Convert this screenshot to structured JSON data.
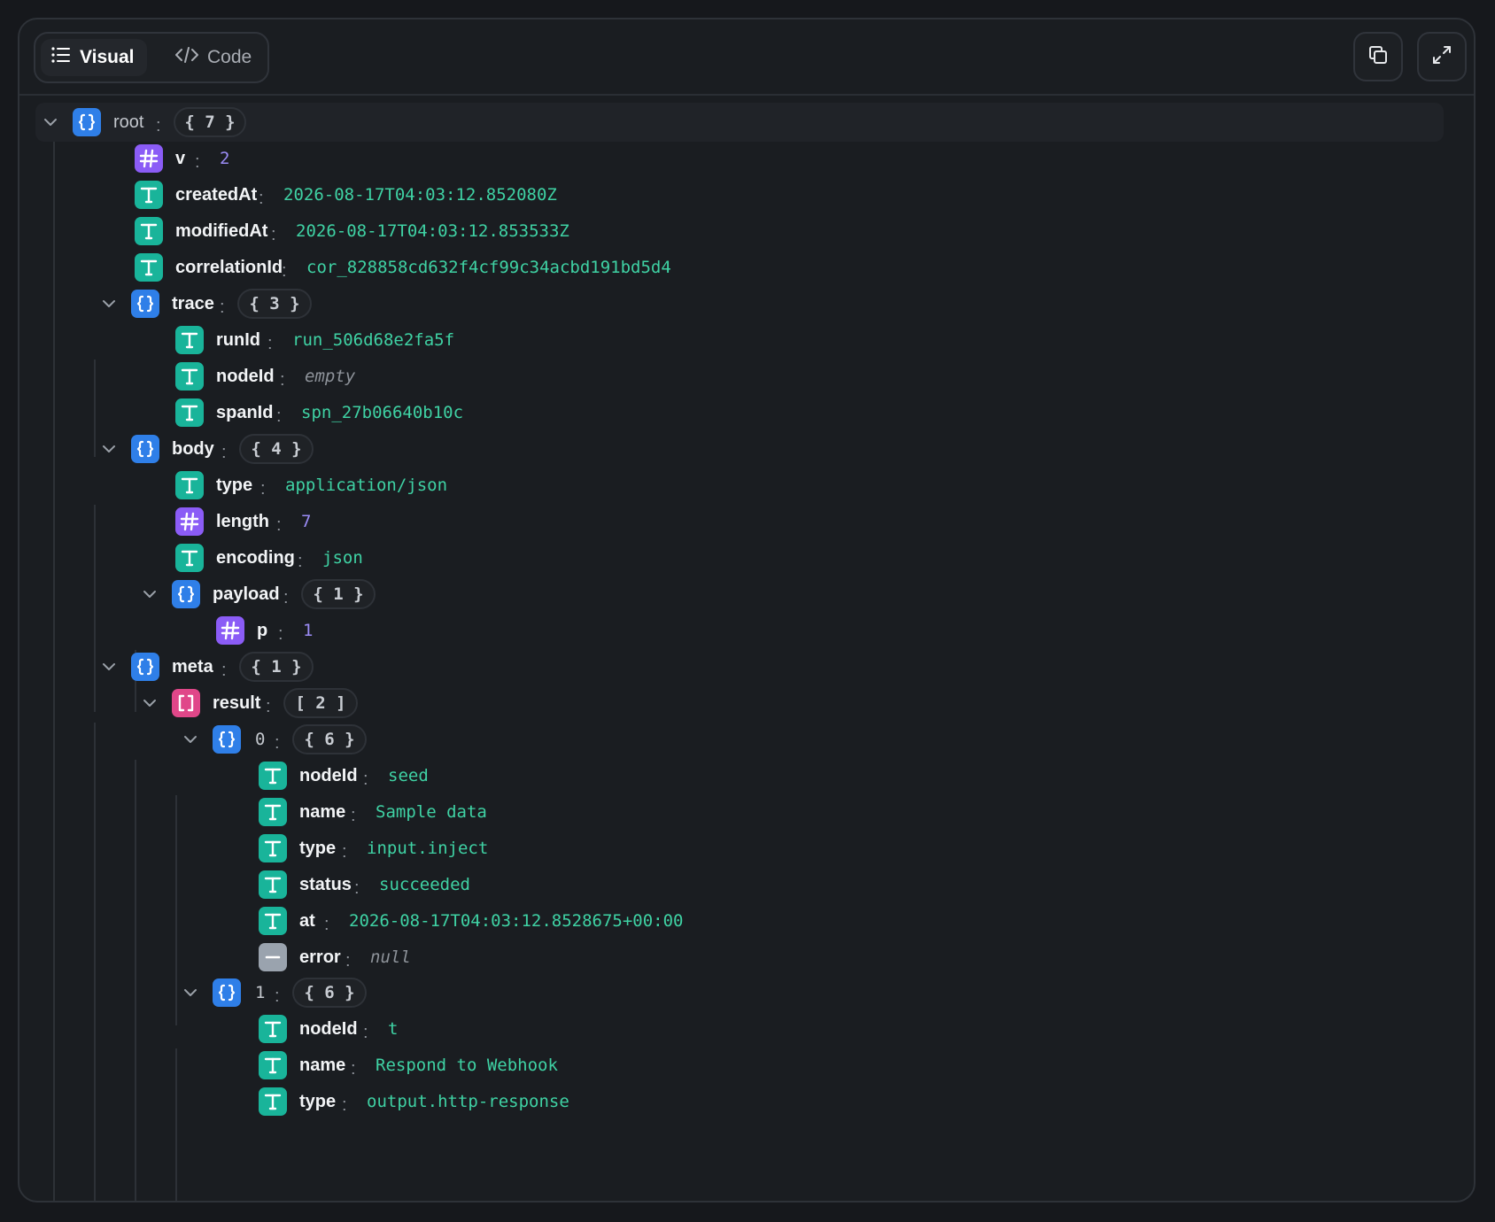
{
  "colors": {
    "background": "#16181c",
    "panel": "#1a1d21",
    "string_icon": "#19b49a",
    "number_icon": "#8b5cf6",
    "object_icon": "#2f7fe8",
    "array_icon": "#e04789",
    "null_icon": "#9aa3ae",
    "string_value": "#3fd2a4",
    "number_value": "#9b8cf5"
  },
  "header": {
    "tabs": [
      {
        "label": "Visual",
        "icon": "list-icon",
        "active": true
      },
      {
        "label": "Code",
        "icon": "code-icon",
        "active": false
      }
    ],
    "actions": [
      {
        "icon": "copy-icon"
      },
      {
        "icon": "expand-icon"
      }
    ]
  },
  "tree": {
    "separator": ":",
    "root": {
      "key": "root",
      "type": "object",
      "count": "{ 7 }",
      "expanded": true
    },
    "v": {
      "key": "v",
      "type": "number",
      "value": "2"
    },
    "createdAt": {
      "key": "createdAt",
      "type": "string",
      "value": "2026-08-17T04:03:12.852080Z"
    },
    "modifiedAt": {
      "key": "modifiedAt",
      "type": "string",
      "value": "2026-08-17T04:03:12.853533Z"
    },
    "correlationId": {
      "key": "correlationId",
      "type": "string",
      "value": "cor_828858cd632f4cf99c34acbd191bd5d4"
    },
    "trace": {
      "key": "trace",
      "type": "object",
      "count": "{ 3 }",
      "expanded": true,
      "runId": {
        "key": "runId",
        "type": "string",
        "value": "run_506d68e2fa5f"
      },
      "nodeId": {
        "key": "nodeId",
        "type": "string",
        "value": "empty"
      },
      "spanId": {
        "key": "spanId",
        "type": "string",
        "value": "spn_27b06640b10c"
      }
    },
    "body": {
      "key": "body",
      "type": "object",
      "count": "{ 4 }",
      "expanded": true,
      "type_field": {
        "key": "type",
        "type": "string",
        "value": "application/json"
      },
      "length": {
        "key": "length",
        "type": "number",
        "value": "7"
      },
      "encoding": {
        "key": "encoding",
        "type": "string",
        "value": "json"
      },
      "payload": {
        "key": "payload",
        "type": "object",
        "count": "{ 1 }",
        "expanded": true,
        "p": {
          "key": "p",
          "type": "number",
          "value": "1"
        }
      }
    },
    "meta": {
      "key": "meta",
      "type": "object",
      "count": "{ 1 }",
      "expanded": true,
      "result": {
        "key": "result",
        "type": "array",
        "count": "[ 2 ]",
        "expanded": true,
        "item0": {
          "key": "0",
          "type": "object",
          "count": "{ 6 }",
          "expanded": true,
          "nodeId": {
            "key": "nodeId",
            "type": "string",
            "value": "seed"
          },
          "name": {
            "key": "name",
            "type": "string",
            "value": "Sample data"
          },
          "type_field": {
            "key": "type",
            "type": "string",
            "value": "input.inject"
          },
          "status": {
            "key": "status",
            "type": "string",
            "value": "succeeded"
          },
          "at": {
            "key": "at",
            "type": "string",
            "value": "2026-08-17T04:03:12.8528675+00:00"
          },
          "error": {
            "key": "error",
            "type": "null",
            "value": "null"
          }
        },
        "item1": {
          "key": "1",
          "type": "object",
          "count": "{ 6 }",
          "expanded": true,
          "nodeId": {
            "key": "nodeId",
            "type": "string",
            "value": "t"
          },
          "name": {
            "key": "name",
            "type": "string",
            "value": "Respond to Webhook"
          },
          "type_field": {
            "key": "type",
            "type": "string",
            "value": "output.http-response"
          }
        }
      }
    }
  }
}
